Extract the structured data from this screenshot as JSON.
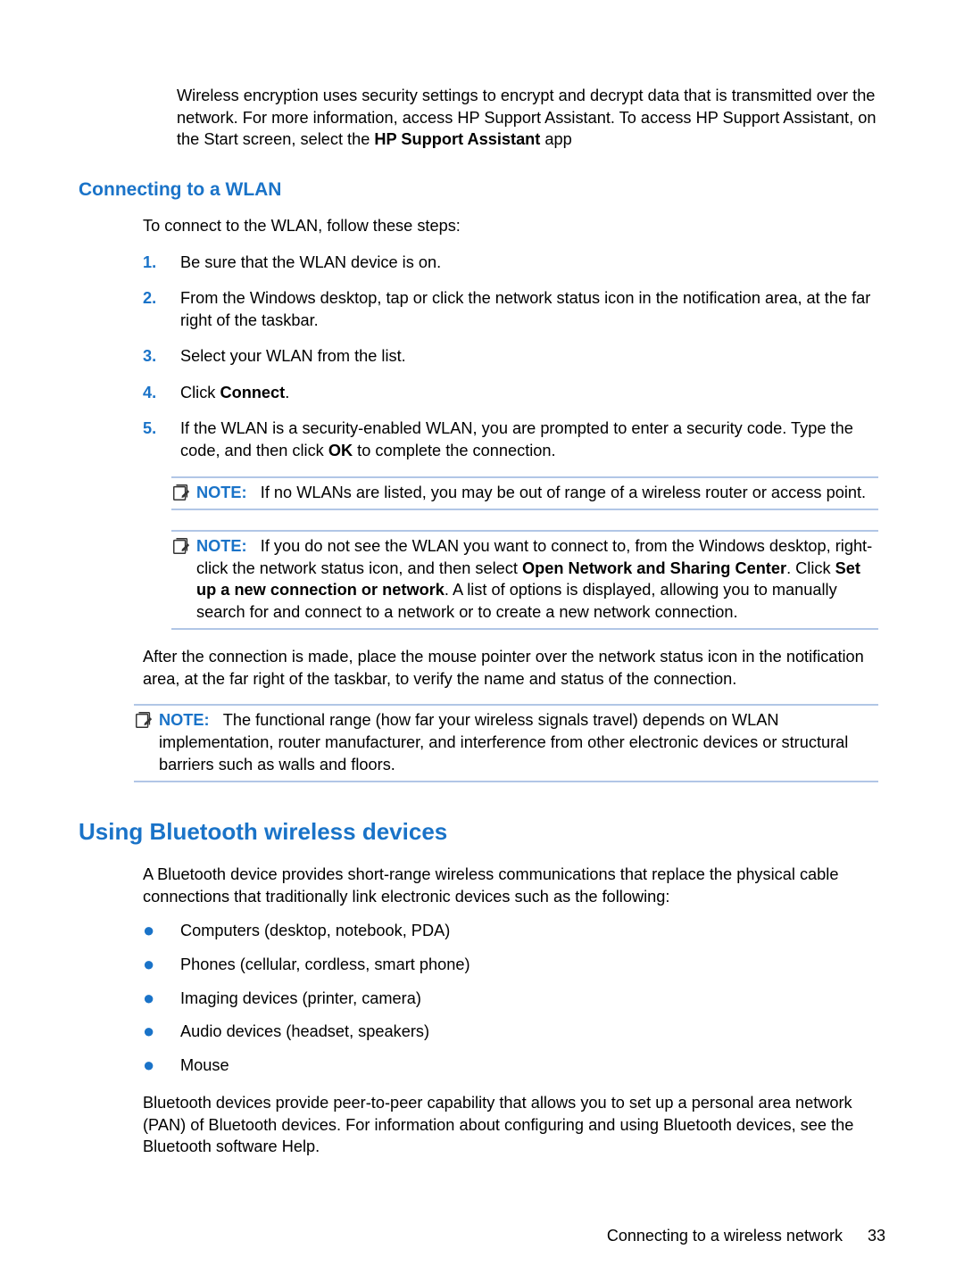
{
  "intro": {
    "text": "Wireless encryption uses security settings to encrypt and decrypt data that is transmitted over the network. For more information, access HP Support Assistant. To access HP Support Assistant, on the Start screen, select the ",
    "bold": "HP Support Assistant",
    "trail": " app"
  },
  "wlan": {
    "heading": "Connecting to a WLAN",
    "intro": "To connect to the WLAN, follow these steps:",
    "steps": {
      "1": {
        "num": "1.",
        "text": "Be sure that the WLAN device is on."
      },
      "2": {
        "num": "2.",
        "text": "From the Windows desktop, tap or click the network status icon in the notification area, at the far right of the taskbar."
      },
      "3": {
        "num": "3.",
        "text": "Select your WLAN from the list."
      },
      "4": {
        "num": "4.",
        "pre": "Click ",
        "bold": "Connect",
        "post": "."
      },
      "5": {
        "num": "5.",
        "pre": "If the WLAN is a security-enabled WLAN, you are prompted to enter a security code. Type the code, and then click ",
        "bold": "OK",
        "post": " to complete the connection."
      }
    },
    "note1": {
      "label": "NOTE:",
      "text": "If no WLANs are listed, you may be out of range of a wireless router or access point."
    },
    "note2": {
      "label": "NOTE:",
      "pre": "If you do not see the WLAN you want to connect to, from the Windows desktop, right-click the network status icon, and then select ",
      "bold1": "Open Network and Sharing Center",
      "mid1": ". Click ",
      "bold2": "Set up a new connection or network",
      "post": ". A list of options is displayed, allowing you to manually search for and connect to a network or to create a new network connection."
    },
    "after": "After the connection is made, place the mouse pointer over the network status icon in the notification area, at the far right of the taskbar, to verify the name and status of the connection.",
    "note3": {
      "label": "NOTE:",
      "text": "The functional range (how far your wireless signals travel) depends on WLAN implementation, router manufacturer, and interference from other electronic devices or structural barriers such as walls and floors."
    }
  },
  "bt": {
    "heading": "Using Bluetooth wireless devices",
    "intro": "A Bluetooth device provides short-range wireless communications that replace the physical cable connections that traditionally link electronic devices such as the following:",
    "bullets": {
      "1": "Computers (desktop, notebook, PDA)",
      "2": "Phones (cellular, cordless, smart phone)",
      "3": "Imaging devices (printer, camera)",
      "4": "Audio devices (headset, speakers)",
      "5": "Mouse"
    },
    "para2": "Bluetooth devices provide peer-to-peer capability that allows you to set up a personal area network (PAN) of Bluetooth devices. For information about configuring and using Bluetooth devices, see the Bluetooth software Help."
  },
  "footer": {
    "section": "Connecting to a wireless network",
    "page": "33"
  }
}
